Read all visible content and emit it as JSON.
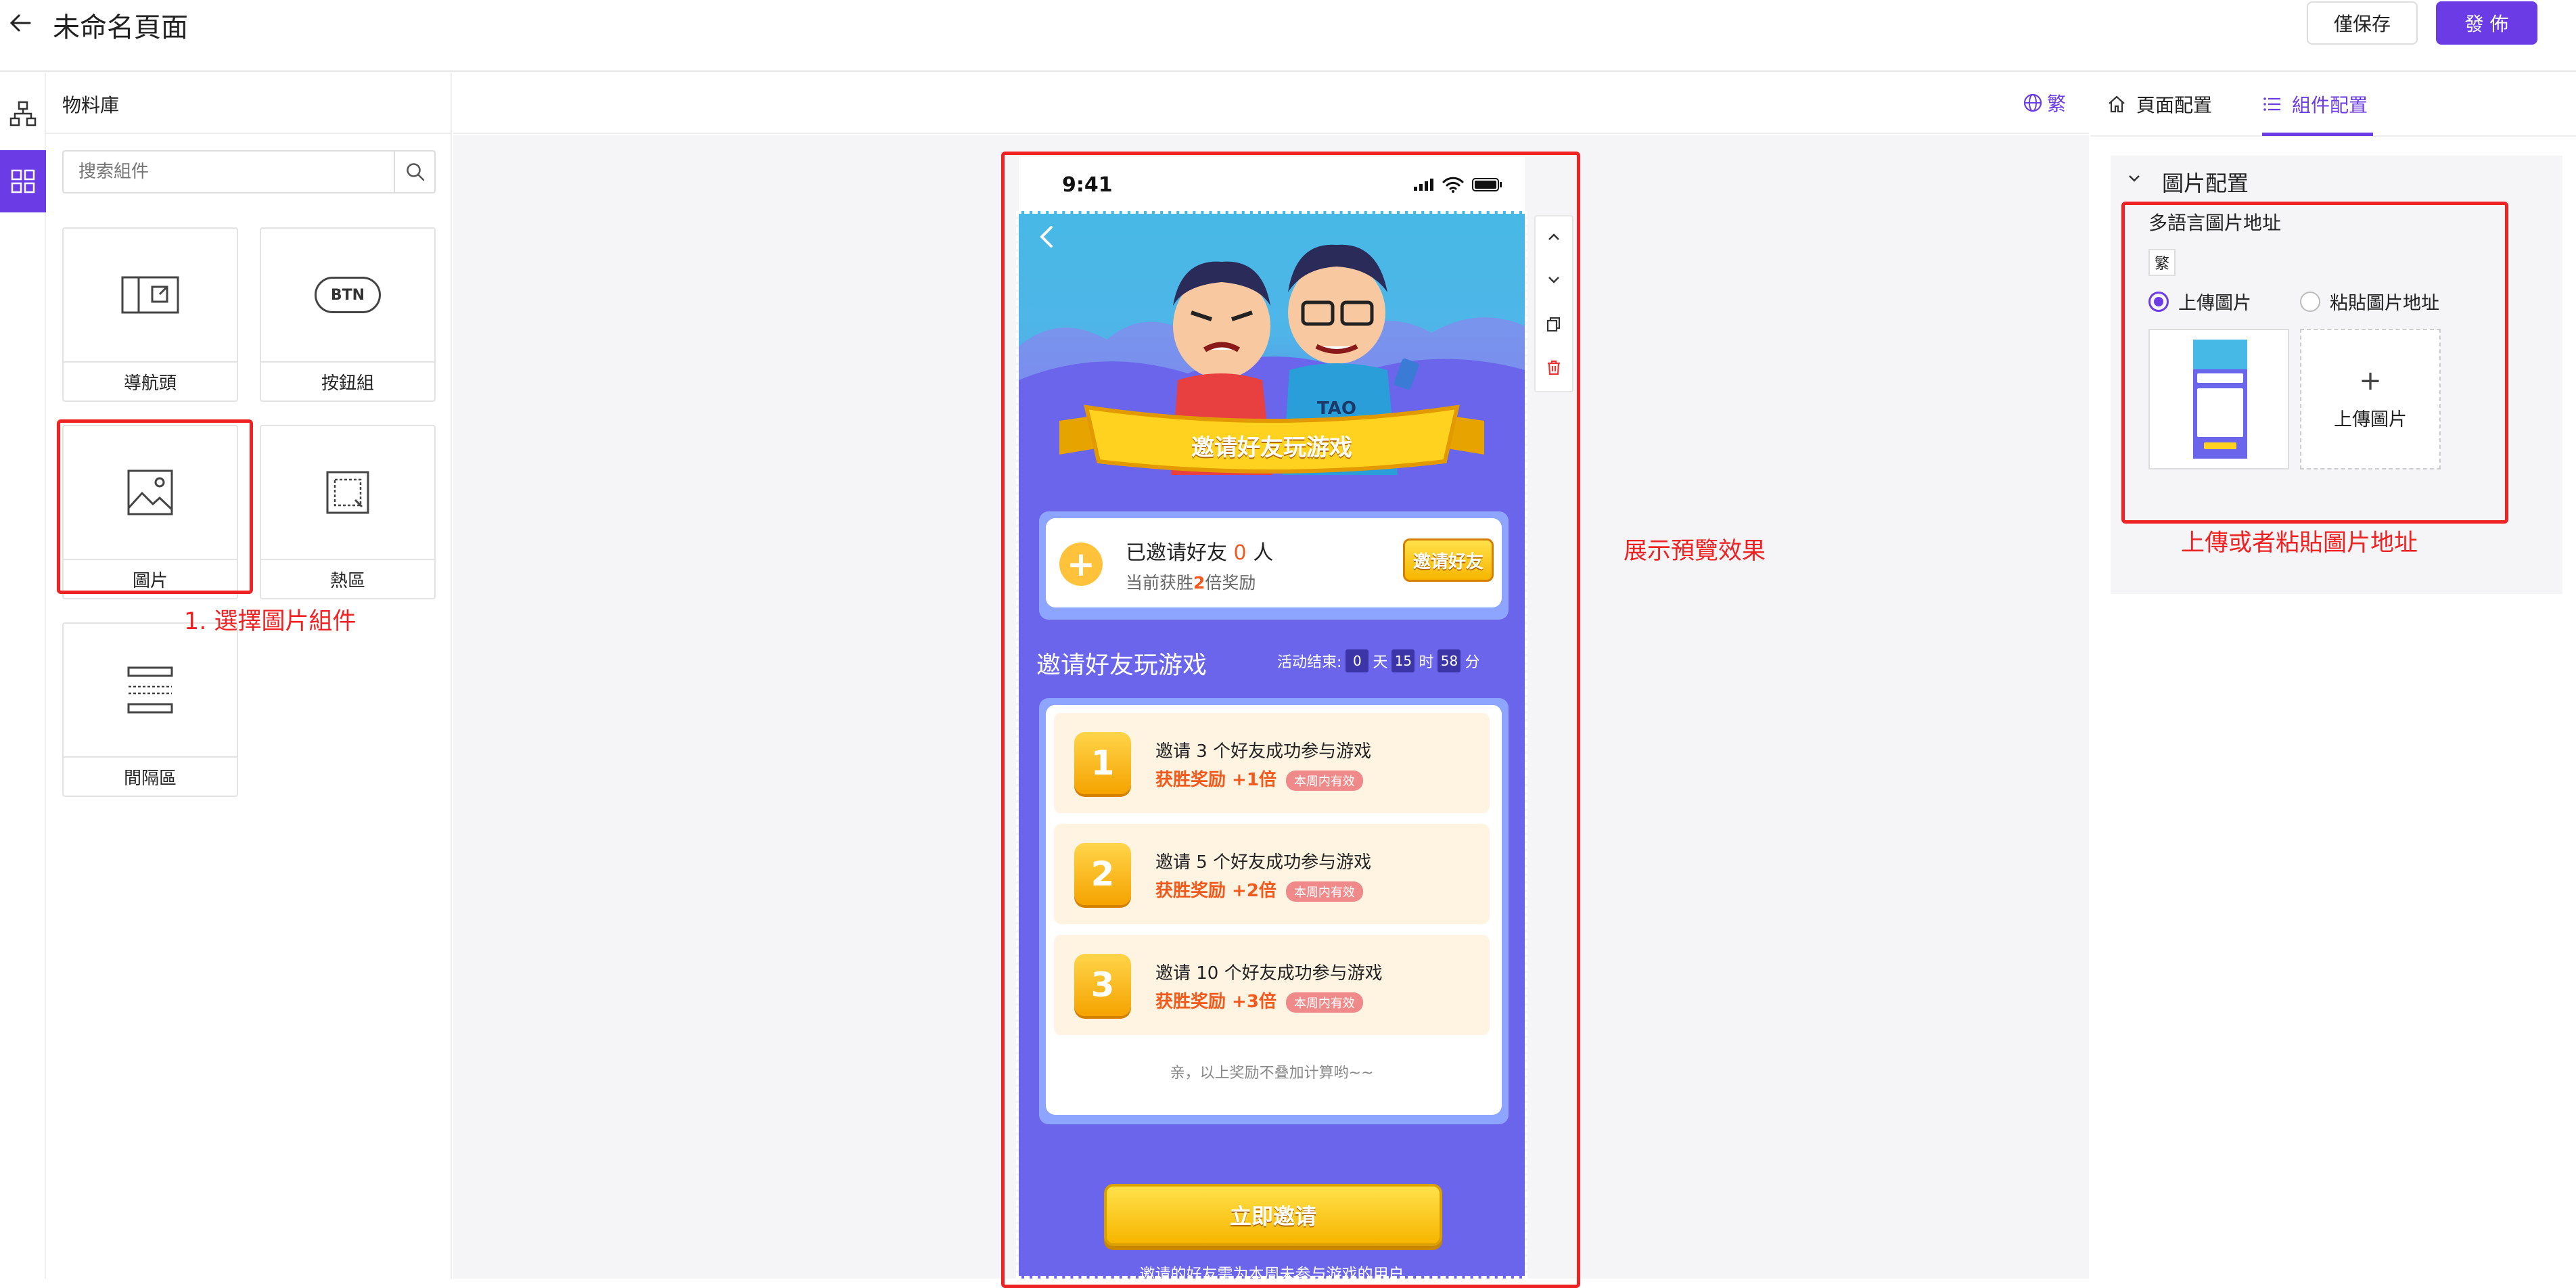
{
  "header": {
    "title": "未命名頁面",
    "save_label": "僅保存",
    "publish_label": "發 佈"
  },
  "sidebar_icons": [
    {
      "icon": "sitemap-icon",
      "active": false
    },
    {
      "icon": "grid-icon",
      "active": true
    }
  ],
  "library": {
    "title": "物料庫",
    "search_placeholder": "搜索組件",
    "components": [
      {
        "label": "導航頭",
        "icon": "nav-header-icon"
      },
      {
        "label": "按鈕組",
        "icon": "button-group-icon",
        "icon_text": "BTN"
      },
      {
        "label": "圖片",
        "icon": "image-icon"
      },
      {
        "label": "熱區",
        "icon": "hotspot-icon"
      },
      {
        "label": "間隔區",
        "icon": "spacer-icon"
      }
    ]
  },
  "canvas": {
    "lang_label": "繁"
  },
  "phone": {
    "time": "9:41",
    "banner_title": "邀请好友玩游戏",
    "invited_prefix": "已邀请好友",
    "invited_count": "0",
    "invited_suffix": "人",
    "bonus_prefix": "当前获胜",
    "bonus_mult": "2",
    "bonus_suffix": "倍奖励",
    "invite_btn": "邀请好友",
    "section_title": "邀请好友玩游戏",
    "countdown_label": "活动结束:",
    "countdown": [
      {
        "value": "0",
        "unit": "天"
      },
      {
        "value": "15",
        "unit": "时"
      },
      {
        "value": "58",
        "unit": "分"
      }
    ],
    "tasks": [
      {
        "num": "1",
        "text": "邀请 3 个好友成功参与游戏",
        "reward": "获胜奖励 +1倍",
        "tag": "本周内有效"
      },
      {
        "num": "2",
        "text": "邀请 5 个好友成功参与游戏",
        "reward": "获胜奖励 +2倍",
        "tag": "本周内有效"
      },
      {
        "num": "3",
        "text": "邀请 10 个好友成功参与游戏",
        "reward": "获胜奖励 +3倍",
        "tag": "本周内有效"
      }
    ],
    "footer_note": "亲，以上奖励不叠加计算哟~~",
    "cta": "立即邀请",
    "cta_note": "邀请的好友需为本周未参与游戏的用户"
  },
  "annotations": {
    "step1": "1. 選擇圖片組件",
    "preview": "展示預覽效果",
    "upload": "上傳或者粘貼圖片地址"
  },
  "right_panel": {
    "tabs": [
      {
        "label": "頁面配置",
        "icon": "home-icon",
        "active": false
      },
      {
        "label": "組件配置",
        "icon": "list-icon",
        "active": true
      }
    ],
    "section_title": "圖片配置",
    "field_label": "多語言圖片地址",
    "lang_badge": "繁",
    "radio_options": [
      {
        "label": "上傳圖片",
        "checked": true
      },
      {
        "label": "粘貼圖片地址",
        "checked": false
      }
    ],
    "upload_label": "上傳圖片"
  },
  "colors": {
    "accent": "#6b3ce6",
    "annotation_red": "#ee2222",
    "phone_bg": "#6a65ea"
  }
}
